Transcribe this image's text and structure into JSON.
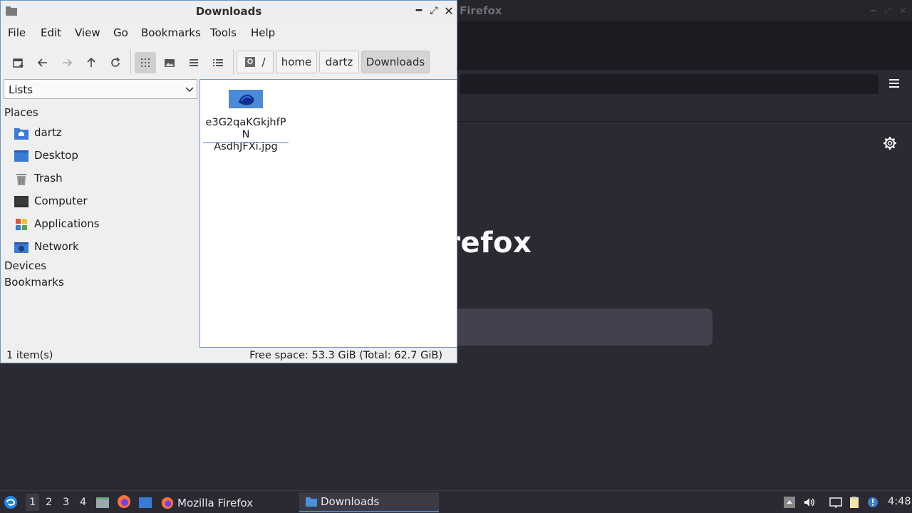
{
  "firefox": {
    "title": "Firefox",
    "brand_partial": "irefox"
  },
  "filemanager": {
    "title": "Downloads",
    "menu": [
      "File",
      "Edit",
      "View",
      "Go",
      "Bookmarks",
      "Tools",
      "Help"
    ],
    "toolbar_icons": [
      "new-tab-icon",
      "back-icon",
      "forward-icon",
      "up-icon",
      "reload-icon",
      "icon-view-icon",
      "thumbnail-view-icon",
      "compact-view-icon",
      "detailed-list-view-icon"
    ],
    "breadcrumb": {
      "root": "/",
      "items": [
        "home",
        "dartz",
        "Downloads"
      ]
    },
    "sidebar": {
      "combo_value": "Lists",
      "places_heading": "Places",
      "places": [
        {
          "label": "dartz",
          "icon": "home-folder-icon"
        },
        {
          "label": "Desktop",
          "icon": "desktop-icon"
        },
        {
          "label": "Trash",
          "icon": "trash-icon"
        },
        {
          "label": "Computer",
          "icon": "computer-icon"
        },
        {
          "label": "Applications",
          "icon": "applications-icon"
        },
        {
          "label": "Network",
          "icon": "network-icon"
        }
      ],
      "devices_heading": "Devices",
      "bookmarks_heading": "Bookmarks"
    },
    "files": [
      {
        "name": "e3G2qaKGkjhfPNAsdhJFXi.jpg",
        "name_line1": "e3G2qaKGkjhfPN",
        "name_line2": "AsdhJFXi.jpg"
      }
    ],
    "status": {
      "count": "1 item(s)",
      "free_space": "Free space: 53.3 GiB (Total: 62.7 GiB)"
    }
  },
  "taskbar": {
    "workspaces": [
      "1",
      "2",
      "3",
      "4"
    ],
    "apps": [
      {
        "label": "Mozilla Firefox"
      },
      {
        "label": "Downloads"
      }
    ],
    "clock": "4:48"
  }
}
